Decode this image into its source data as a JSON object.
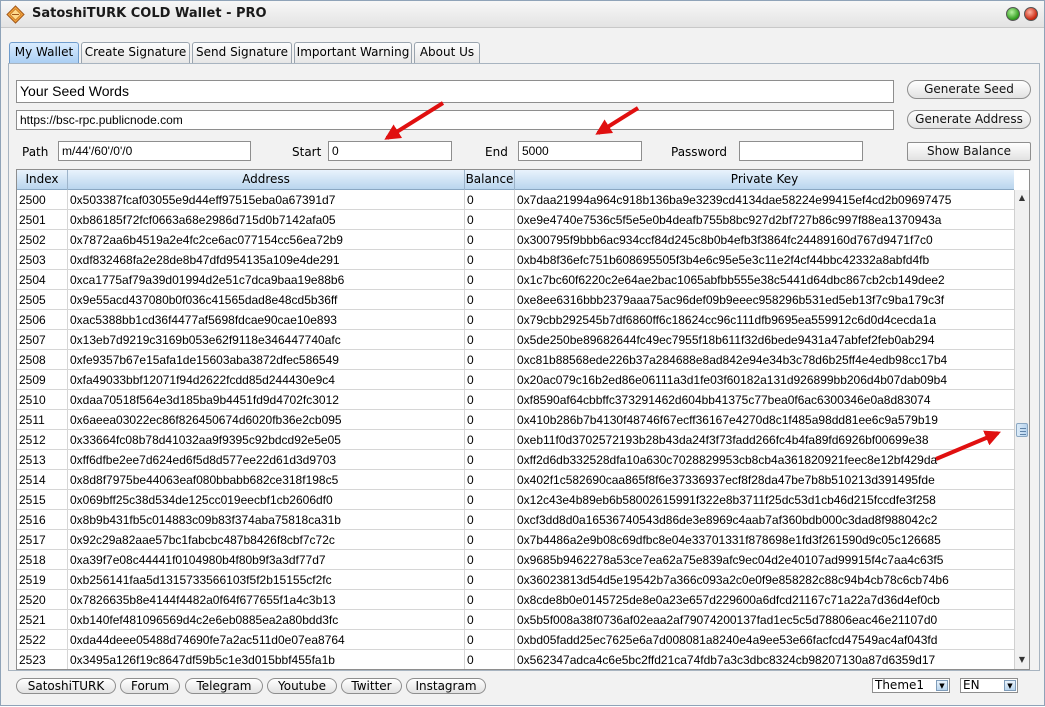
{
  "window": {
    "title": "SatoshiTURK COLD Wallet - PRO"
  },
  "tabs": [
    {
      "label": "My Wallet",
      "active": true
    },
    {
      "label": "Create Signature",
      "active": false
    },
    {
      "label": "Send Signature",
      "active": false
    },
    {
      "label": "Important Warning",
      "active": false
    },
    {
      "label": "About Us",
      "active": false
    }
  ],
  "form": {
    "seed_value": "Your Seed Words",
    "rpc_value": "https://bsc-rpc.publicnode.com",
    "path_label": "Path",
    "path_value": "m/44'/60'/0'/0",
    "start_label": "Start",
    "start_value": "0",
    "end_label": "End",
    "end_value": "5000",
    "password_label": "Password",
    "password_value": "",
    "generate_seed_label": "Generate Seed",
    "generate_address_label": "Generate Address",
    "show_balance_label": "Show Balance"
  },
  "table": {
    "columns": [
      "Index",
      "Address",
      "Balance",
      "Private Key"
    ],
    "rows": [
      [
        "2500",
        "0x503387fcaf03055e9d44eff97515eba0a67391d7",
        "0",
        "0x7daa21994a964c918b136ba9e3239cd4134dae58224e99415ef4cd2b09697475"
      ],
      [
        "2501",
        "0xb86185f72fcf0663a68e2986d715d0b7142afa05",
        "0",
        "0xe9e4740e7536c5f5e5e0b4deafb755b8bc927d2bf727b86c997f88ea1370943a"
      ],
      [
        "2502",
        "0x7872aa6b4519a2e4fc2ce6ac077154cc56ea72b9",
        "0",
        "0x300795f9bbb6ac934ccf84d245c8b0b4efb3f3864fc24489160d767d9471f7c0"
      ],
      [
        "2503",
        "0xdf832468fa2e28de8b47dfd954135a109e4de291",
        "0",
        "0xb4b8f36efc751b608695505f3b4e6c95e5e3c11e2f4cf44bbc42332a8abfd4fb"
      ],
      [
        "2504",
        "0xca1775af79a39d01994d2e51c7dca9baa19e88b6",
        "0",
        "0x1c7bc60f6220c2e64ae2bac1065abfbb555e38c5441d64dbc867cb2cb149dee2"
      ],
      [
        "2505",
        "0x9e55acd437080b0f036c41565dad8e48cd5b36ff",
        "0",
        "0xe8ee6316bbb2379aaa75ac96def09b9eeec958296b531ed5eb13f7c9ba179c3f"
      ],
      [
        "2506",
        "0xac5388bb1cd36f4477af5698fdcae90cae10e893",
        "0",
        "0x79cbb292545b7df6860ff6c18624cc96c111dfb9695ea559912c6d0d4cecda1a"
      ],
      [
        "2507",
        "0x13eb7d9219c3169b053e62f9118e346447740afc",
        "0",
        "0x5de250be89682644fc49ec7955f18b611f32d6bede9431a47abfef2feb0ab294"
      ],
      [
        "2508",
        "0xfe9357b67e15afa1de15603aba3872dfec586549",
        "0",
        "0xc81b88568ede226b37a284688e8ad842e94e34b3c78d6b25ff4e4edb98cc17b4"
      ],
      [
        "2509",
        "0xfa49033bbf12071f94d2622fcdd85d244430e9c4",
        "0",
        "0x20ac079c16b2ed86e06111a3d1fe03f60182a131d926899bb206d4b07dab09b4"
      ],
      [
        "2510",
        "0xdaa70518f564e3d185ba9b4451fd9d4702fc3012",
        "0",
        "0xf8590af64cbbffc373291462d604bb41375c77bea0f6ac6300346e0a8d83074"
      ],
      [
        "2511",
        "0x6aeea03022ec86f826450674d6020fb36e2cb095",
        "0",
        "0x410b286b7b4130f48746f67ecff36167e4270d8c1f485a98dd81ee6c9a579b19"
      ],
      [
        "2512",
        "0x33664fc08b78d41032aa9f9395c92bdcd92e5e05",
        "0",
        "0xeb11f0d3702572193b28b43da24f3f73fadd266fc4b4fa89fd6926bf00699e38"
      ],
      [
        "2513",
        "0xff6dfbe2ee7d624ed6f5d8d577ee22d61d3d9703",
        "0",
        "0xff2d6db332528dfa10a630c7028829953cb8cb4a361820921feec8e12bf429da"
      ],
      [
        "2514",
        "0x8d8f7975be44063eaf080bbabb682ce318f198c5",
        "0",
        "0x402f1c582690caa865f8f6e37336937ecf8f28da47be7b8b510213d391495fde"
      ],
      [
        "2515",
        "0x069bff25c38d534de125cc019eecbf1cb2606df0",
        "0",
        "0x12c43e4b89eb6b58002615991f322e8b3711f25dc53d1cb46d215fccdfe3f258"
      ],
      [
        "2516",
        "0x8b9b431fb5c014883c09b83f374aba75818ca31b",
        "0",
        "0xcf3dd8d0a16536740543d86de3e8969c4aab7af360bdb000c3dad8f988042c2"
      ],
      [
        "2517",
        "0x92c29a82aae57bc1fabcbc487b8426f8cbf7c72c",
        "0",
        "0x7b4486a2e9b08c69dfbc8e04e33701331f878698e1fd3f261590d9c05c126685"
      ],
      [
        "2518",
        "0xa39f7e08c44441f0104980b4f80b9f3a3df77d7",
        "0",
        "0x9685b9462278a53ce7ea62a75e839afc9ec04d2e40107ad99915f4c7aa4c63f5"
      ],
      [
        "2519",
        "0xb256141faa5d1315733566103f5f2b15155cf2fc",
        "0",
        "0x36023813d54d5e19542b7a366c093a2c0e0f9e858282c88c94b4cb78c6cb74b6"
      ],
      [
        "2520",
        "0x7826635b8e4144f4482a0f64f677655f1a4c3b13",
        "0",
        "0x8cde8b0e0145725de8e0a23e657d229600a6dfcd21167c71a22a7d36d4ef0cb"
      ],
      [
        "2521",
        "0xb140fef481096569d4c2e6eb0885ea2a80bdd3fc",
        "0",
        "0x5b5f008a38f0736af02eaa2af79074200137fad1ec5c5d78806eac46e21107d0"
      ],
      [
        "2522",
        "0xda44deee05488d74690fe7a2ac511d0e07ea8764",
        "0",
        "0xbd05fadd25ec7625e6a7d008081a8240e4a9ee53e66facfcd47549ac4af043fd"
      ],
      [
        "2523",
        "0x3495a126f19c8647df59b5c1e3d015bbf455fa1b",
        "0",
        "0x562347adca4c6e5bc2ffd21ca74fdb7a3c3dbc8324cb98207130a87d6359d17"
      ]
    ]
  },
  "scrollbar": {
    "position": 0.5
  },
  "footer": {
    "links": [
      "SatoshiTURK",
      "Forum",
      "Telegram",
      "Youtube",
      "Twitter",
      "Instagram"
    ],
    "theme_value": "Theme1",
    "language_value": "EN"
  },
  "colors": {
    "annotation_arrow": "#e01010",
    "tab_active": "#a8cdf2",
    "header_bg": "#b9d5ee"
  },
  "icons": {
    "app": "diamond-logo-icon",
    "maximize": "green-circle-icon",
    "close": "red-circle-icon",
    "dropdown": "triangle-down-icon"
  }
}
